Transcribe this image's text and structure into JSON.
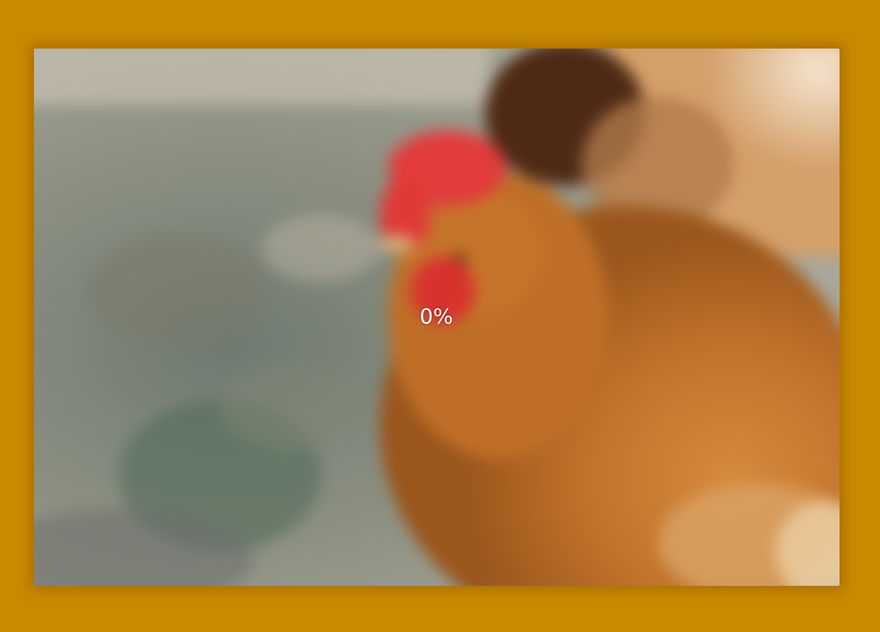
{
  "loader": {
    "progress_text": "0%",
    "progress": 0
  },
  "image": {
    "subject": "chicken-photo"
  },
  "colors": {
    "frame": "#c98a00",
    "text": "#ffffff"
  }
}
